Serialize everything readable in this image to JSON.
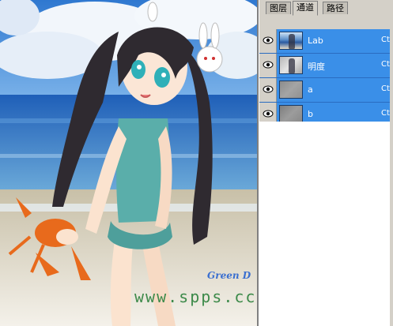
{
  "canvas": {
    "watermark_small": "Green D",
    "watermark_url": "www.spps.cc"
  },
  "panel": {
    "tabs": [
      {
        "label": "图层",
        "active": false
      },
      {
        "label": "通道",
        "active": true
      },
      {
        "label": "路径",
        "active": false
      }
    ],
    "channels": [
      {
        "name": "Lab",
        "shortcut": "Ctr",
        "thumb": "color"
      },
      {
        "name": "明度",
        "shortcut": "Ctr",
        "thumb": "gray-light"
      },
      {
        "name": "a",
        "shortcut": "Ctr",
        "thumb": "gray-mid"
      },
      {
        "name": "b",
        "shortcut": "Ctr",
        "thumb": "gray-mid2"
      }
    ],
    "colors": {
      "selection": "#3a8fe8",
      "panel_bg": "#d4d0c8"
    }
  }
}
